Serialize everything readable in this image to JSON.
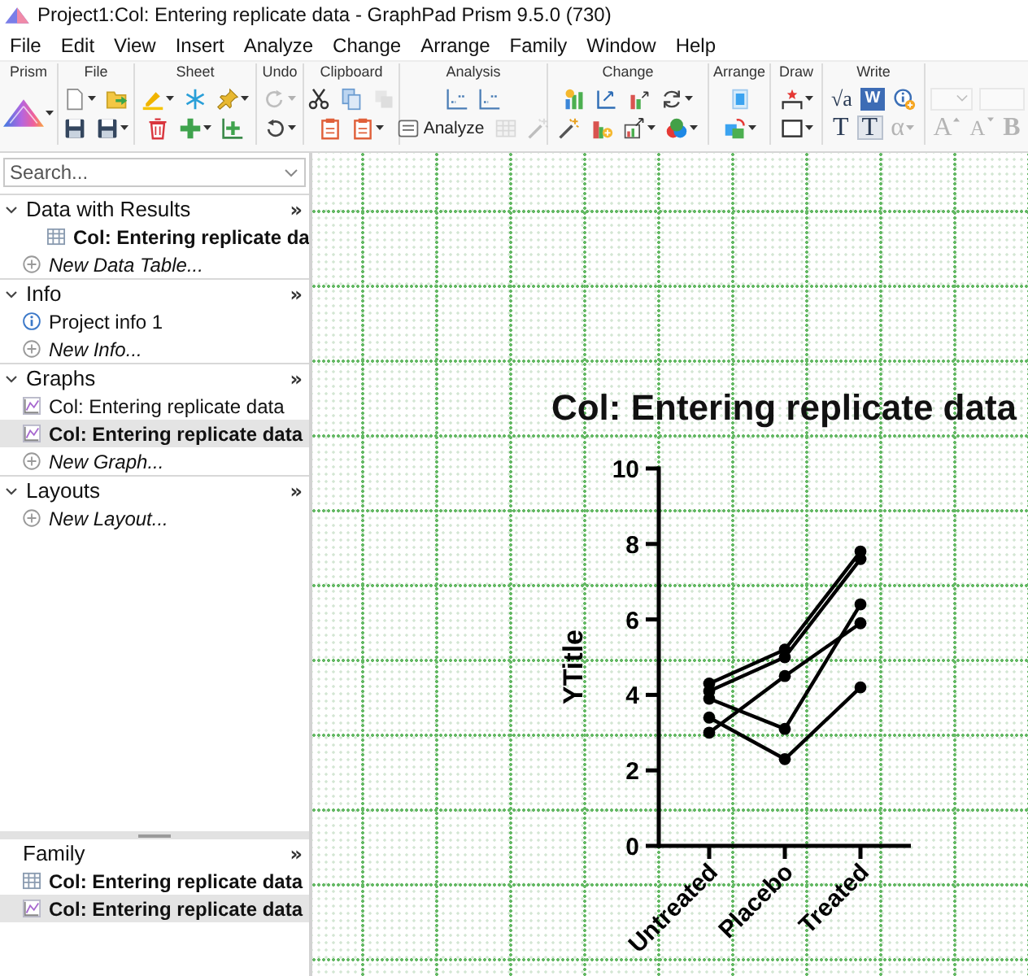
{
  "window": {
    "title": "Project1:Col: Entering replicate data - GraphPad Prism 9.5.0 (730)"
  },
  "menu": [
    "File",
    "Edit",
    "View",
    "Insert",
    "Analyze",
    "Change",
    "Arrange",
    "Family",
    "Window",
    "Help"
  ],
  "toolbar": {
    "groups": [
      {
        "label": "Prism",
        "rows": [
          [
            {
              "kind": "icon",
              "menu": true,
              "disabled": false
            }
          ]
        ]
      },
      {
        "label": "File",
        "rows": [
          [
            {
              "kind": "icon",
              "menu": true,
              "disabled": false
            },
            {
              "kind": "icon",
              "menu": false,
              "disabled": false
            }
          ],
          [
            {
              "kind": "icon",
              "menu": false,
              "disabled": false
            },
            {
              "kind": "icon",
              "menu": true,
              "disabled": false
            }
          ]
        ]
      },
      {
        "label": "Sheet",
        "rows": [
          [
            {
              "kind": "icon",
              "menu": true,
              "disabled": false
            },
            {
              "kind": "icon",
              "menu": false,
              "disabled": false
            },
            {
              "kind": "icon",
              "menu": true,
              "disabled": false
            }
          ],
          [
            {
              "kind": "icon",
              "menu": false,
              "disabled": false
            },
            {
              "kind": "icon",
              "menu": true,
              "disabled": false
            },
            {
              "kind": "icon",
              "menu": false,
              "disabled": false
            }
          ]
        ]
      },
      {
        "label": "Undo",
        "rows": [
          [
            {
              "kind": "icon",
              "menu": true,
              "disabled": true
            }
          ],
          [
            {
              "kind": "icon",
              "menu": true,
              "disabled": false
            }
          ]
        ]
      },
      {
        "label": "Clipboard",
        "rows": [
          [
            {
              "kind": "icon",
              "menu": false,
              "disabled": false
            },
            {
              "kind": "icon",
              "menu": false,
              "disabled": false
            },
            {
              "kind": "icon",
              "menu": false,
              "disabled": true
            }
          ],
          [
            {
              "kind": "icon",
              "menu": false,
              "disabled": false
            },
            {
              "kind": "icon",
              "menu": true,
              "disabled": false
            }
          ]
        ]
      },
      {
        "label": "Analysis",
        "rows": [
          [
            {
              "kind": "icon",
              "menu": false,
              "disabled": false
            },
            {
              "kind": "icon",
              "menu": false,
              "disabled": false
            }
          ],
          [
            {
              "kind": "text",
              "label": "Analyze",
              "menu": false,
              "disabled": false
            },
            {
              "kind": "icon",
              "menu": false,
              "disabled": true
            },
            {
              "kind": "icon",
              "menu": false,
              "disabled": true
            }
          ]
        ]
      },
      {
        "label": "Change",
        "rows": [
          [
            {
              "kind": "icon",
              "menu": false,
              "disabled": false
            },
            {
              "kind": "icon",
              "menu": false,
              "disabled": false
            },
            {
              "kind": "icon",
              "menu": false,
              "disabled": false
            },
            {
              "kind": "icon",
              "menu": true,
              "disabled": false
            }
          ],
          [
            {
              "kind": "icon",
              "menu": false,
              "disabled": false
            },
            {
              "kind": "icon",
              "menu": false,
              "disabled": false
            },
            {
              "kind": "icon",
              "menu": true,
              "disabled": false
            },
            {
              "kind": "icon",
              "menu": true,
              "disabled": false
            }
          ]
        ]
      },
      {
        "label": "Arrange",
        "rows": [
          [
            {
              "kind": "icon",
              "menu": false,
              "disabled": false
            }
          ],
          [
            {
              "kind": "icon",
              "menu": true,
              "disabled": false
            }
          ]
        ]
      },
      {
        "label": "Draw",
        "rows": [
          [
            {
              "kind": "icon",
              "menu": true,
              "disabled": false
            }
          ],
          [
            {
              "kind": "icon",
              "menu": true,
              "disabled": false
            }
          ]
        ]
      },
      {
        "label": "Write",
        "rows": [
          [
            {
              "kind": "glyph",
              "label": "√a",
              "menu": false,
              "disabled": false
            },
            {
              "kind": "glyph",
              "label": "W",
              "menu": false,
              "disabled": false
            },
            {
              "kind": "icon",
              "menu": false,
              "disabled": false
            }
          ],
          [
            {
              "kind": "glyph",
              "label": "T",
              "menu": false,
              "disabled": false
            },
            {
              "kind": "glyph",
              "label": "T",
              "menu": false,
              "disabled": false
            },
            {
              "kind": "glyph",
              "label": "α",
              "menu": true,
              "disabled": true
            }
          ]
        ]
      },
      {
        "rows": [
          [
            {
              "kind": "dropdown",
              "menu": true,
              "disabled": true
            },
            {
              "kind": "field",
              "menu": false,
              "disabled": true
            }
          ],
          [
            {
              "kind": "glyph",
              "label": "A",
              "menu": false,
              "disabled": true
            },
            {
              "kind": "glyph",
              "label": "A",
              "menu": false,
              "disabled": true
            },
            {
              "kind": "glyph",
              "label": "B",
              "menu": false,
              "disabled": true
            }
          ]
        ]
      }
    ]
  },
  "navigator": {
    "search": {
      "placeholder": "Search..."
    },
    "sections": [
      {
        "title": "Data with Results",
        "toggle": "»",
        "expanded": true,
        "items": [
          {
            "kind": "data",
            "label": "Col: Entering replicate da",
            "bold": true,
            "selected": false
          },
          {
            "kind": "new",
            "label": "New Data Table...",
            "bold": false,
            "selected": false
          }
        ]
      },
      {
        "title": "Info",
        "toggle": "»",
        "expanded": true,
        "items": [
          {
            "kind": "info",
            "label": "Project info 1",
            "bold": false,
            "selected": false
          },
          {
            "kind": "new",
            "label": "New Info...",
            "bold": false,
            "selected": false
          }
        ]
      },
      {
        "title": "Graphs",
        "toggle": "»",
        "expanded": true,
        "items": [
          {
            "kind": "graph",
            "label": "Col: Entering replicate data",
            "bold": false,
            "selected": false
          },
          {
            "kind": "graph",
            "label": "Col: Entering replicate data",
            "bold": true,
            "selected": true
          },
          {
            "kind": "new",
            "label": "New Graph...",
            "bold": false,
            "selected": false
          }
        ]
      },
      {
        "title": "Layouts",
        "toggle": "»",
        "expanded": true,
        "items": [
          {
            "kind": "new",
            "label": "New Layout...",
            "bold": false,
            "selected": false
          }
        ]
      }
    ],
    "family": {
      "title": "Family",
      "toggle": "»",
      "items": [
        {
          "kind": "data",
          "label": "Col: Entering replicate data",
          "bold": true,
          "selected": false
        },
        {
          "kind": "graph",
          "label": "Col: Entering replicate data",
          "bold": true,
          "selected": true
        }
      ]
    }
  },
  "canvas": {
    "chart_data": {
      "type": "line",
      "title": "Col: Entering replicate data",
      "ylabel": "YTitle",
      "categories": [
        "Untreated",
        "Placebo",
        "Treated"
      ],
      "series": [
        {
          "marker": "circle",
          "values": [
            4.3,
            5.2,
            7.8
          ]
        },
        {
          "marker": "circle",
          "values": [
            4.1,
            5.0,
            7.6
          ]
        },
        {
          "marker": "circle",
          "values": [
            3.0,
            4.5,
            5.9
          ]
        },
        {
          "marker": "circle",
          "values": [
            3.9,
            3.1,
            6.4
          ]
        },
        {
          "marker": "circle",
          "values": [
            3.4,
            2.3,
            4.2
          ]
        }
      ],
      "ylim": [
        0,
        10
      ],
      "yticks": [
        0,
        2,
        4,
        6,
        8,
        10
      ]
    }
  }
}
